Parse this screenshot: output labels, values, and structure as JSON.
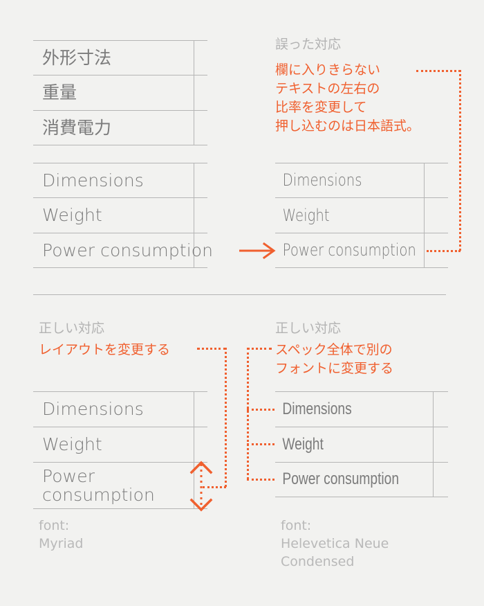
{
  "colors": {
    "background": "#f2f2f0",
    "accent_orange": "#f0602f",
    "text_gray": "#7b7b7b",
    "caption_gray": "#b3b3b3",
    "rule_gray": "#b5b5b5"
  },
  "panels": {
    "top_left": {
      "jp_table": {
        "rows": [
          "外形寸法",
          "重量",
          "消費電力"
        ]
      },
      "latin_table": {
        "rows": [
          "Dimensions",
          "Weight",
          "Power consumption"
        ]
      }
    },
    "top_right": {
      "heading": "誤った対応",
      "annotation": "欄に入りきらない\nテキストの左右の\n比率を変更して\n押し込むのは日本語式。",
      "latin_table": {
        "rows": [
          "Dimensions",
          "Weight",
          "Power consumption"
        ]
      }
    },
    "bottom_left": {
      "heading": "正しい対応",
      "annotation": "レイアウトを変更する",
      "latin_table": {
        "rows": [
          "Dimensions",
          "Weight",
          "Power consumption"
        ]
      },
      "font_note": "font:\nMyriad"
    },
    "bottom_right": {
      "heading": "正しい対応",
      "annotation": "スペック全体で別の\nフォントに変更する",
      "latin_table": {
        "rows": [
          "Dimensions",
          "Weight",
          "Power consumption"
        ]
      },
      "font_note": "font:\nHelevetica Neue\nCondensed"
    }
  },
  "icons": {
    "transform_arrow": "arrow-right-icon",
    "row_height_arrow": "double-arrow-vertical-icon"
  }
}
